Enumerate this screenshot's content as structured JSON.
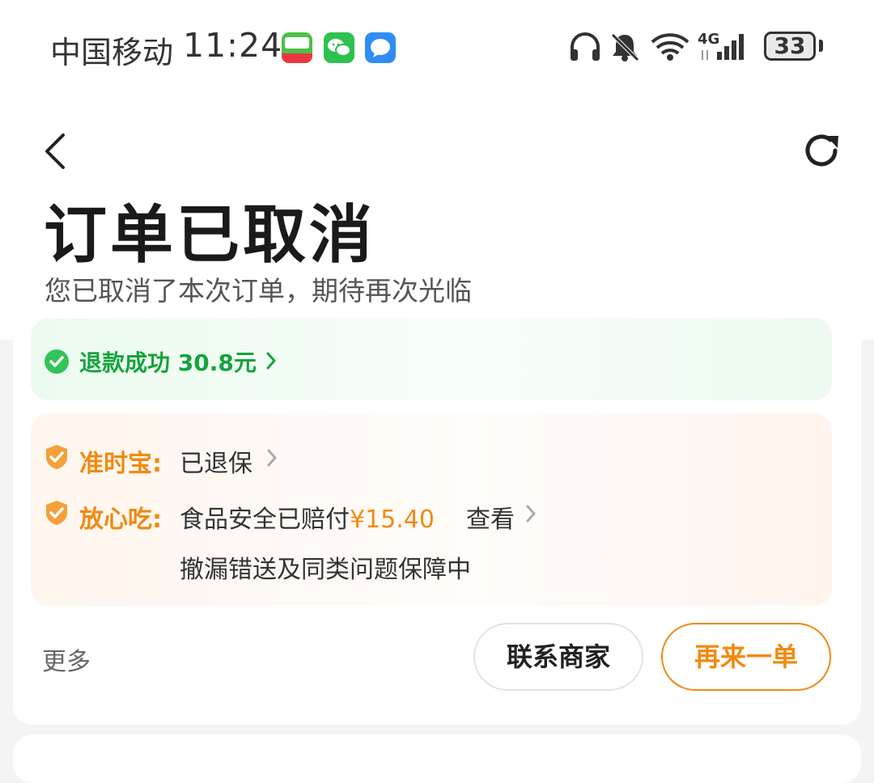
{
  "status_bar": {
    "carrier": "中国移动",
    "time": "11:24",
    "network": "4G",
    "battery": "33",
    "app_icons": [
      "lottery-app-icon",
      "wechat-icon",
      "message-app-icon"
    ],
    "status_icons": [
      "headphones-icon",
      "bell-muted-icon",
      "wifi-icon",
      "signal-icon"
    ]
  },
  "header": {
    "back_icon": "chevron-left-icon",
    "refresh_icon": "refresh-icon",
    "title": "订单已取消",
    "subtitle": "您已取消了本次订单，期待再次光临"
  },
  "refund": {
    "text": "退款成功 30.8元",
    "icon": "check-circle-icon",
    "color": "#16a33e"
  },
  "guarantees": {
    "ontime": {
      "label": "准时宝:",
      "value": "已退保",
      "icon": "shield-check-icon"
    },
    "safe_eat": {
      "label": "放心吃:",
      "value": "食品安全已赔付",
      "amount": "¥15.40",
      "link": "查看",
      "note": "撤漏错送及同类问题保障中",
      "icon": "shield-check-icon"
    },
    "accent": "#f08a12"
  },
  "actions": {
    "more": "更多",
    "contact": "联系商家",
    "reorder": "再来一单"
  }
}
